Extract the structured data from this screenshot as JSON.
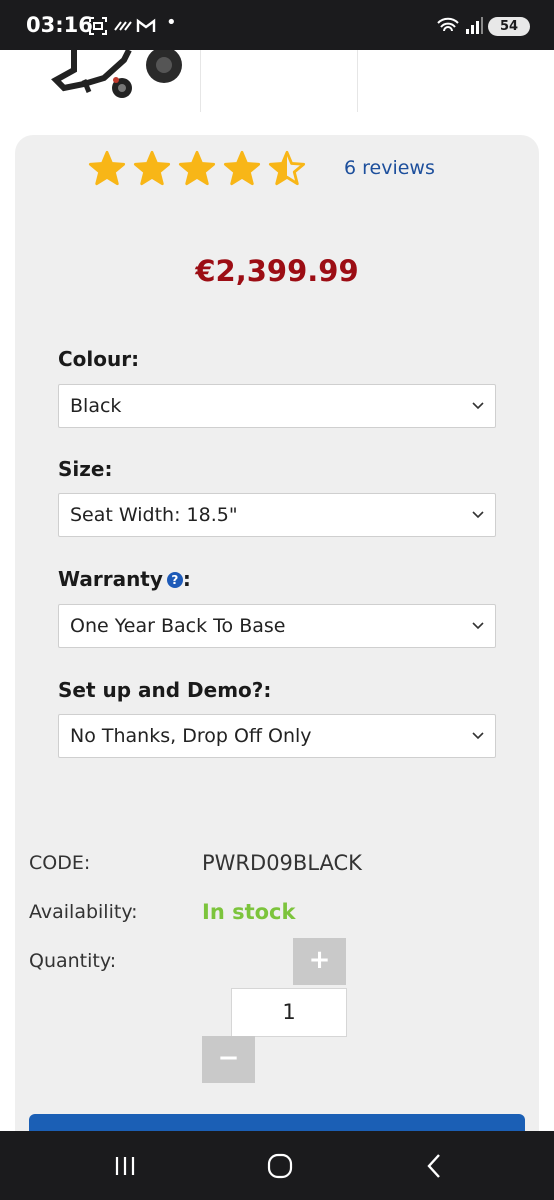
{
  "status_bar": {
    "time": "03:16",
    "battery": "54"
  },
  "product": {
    "rating": 4.5,
    "rating_max": 5,
    "reviews_link": "6 reviews",
    "price": "€2,399.99"
  },
  "options": [
    {
      "label": "Colour:",
      "value": "Black"
    },
    {
      "label": "Size:",
      "value": "Seat Width: 18.5\""
    },
    {
      "label": "Warranty",
      "help_icon": "?",
      "label_suffix": ":",
      "value": "One Year Back To Base"
    },
    {
      "label": "Set up and Demo?:",
      "value": "No Thanks, Drop Off Only"
    }
  ],
  "info": {
    "code_label": "CODE:",
    "code_value": "PWRD09BLACK",
    "availability_label": "Availability:",
    "availability_value": "In stock",
    "quantity_label": "Quantity:",
    "quantity_value": "1",
    "plus": "+",
    "minus": "−"
  },
  "colors": {
    "price": "#9c0d14",
    "link": "#1d4f9c",
    "stock": "#7cc43c",
    "star": "#f8b617",
    "cta": "#1b5fb5"
  }
}
